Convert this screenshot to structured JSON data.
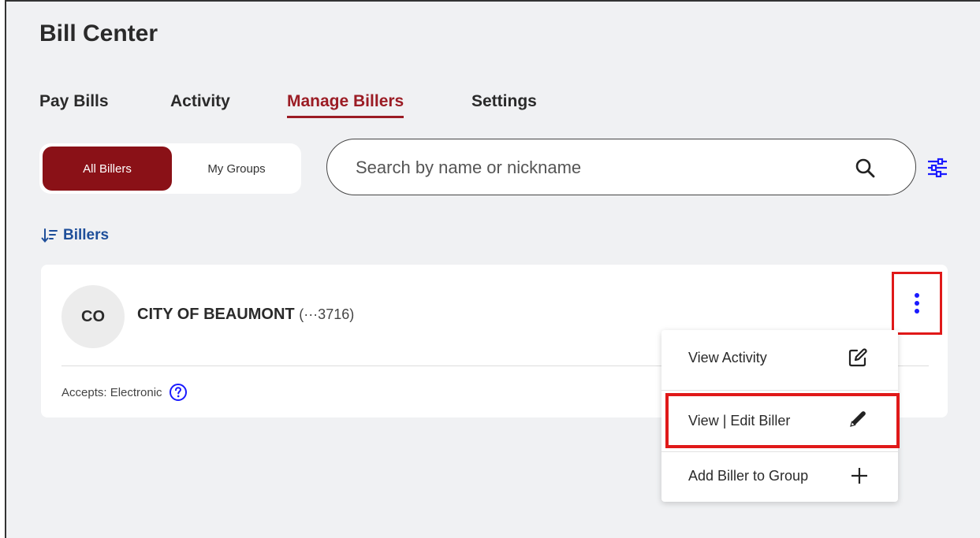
{
  "page": {
    "title": "Bill Center"
  },
  "tabs": [
    {
      "label": "Pay Bills",
      "active": false
    },
    {
      "label": "Activity",
      "active": false
    },
    {
      "label": "Manage Billers",
      "active": true
    },
    {
      "label": "Settings",
      "active": false
    }
  ],
  "segment": {
    "all_label": "All Billers",
    "groups_label": "My Groups",
    "selected": "All Billers"
  },
  "search": {
    "placeholder": "Search by name or nickname",
    "value": ""
  },
  "sort": {
    "label": "Billers"
  },
  "biller": {
    "initials": "CO",
    "name": "CITY OF BEAUMONT",
    "account": "(···3716)",
    "accepts": "Accepts: Electronic"
  },
  "menu": {
    "items": [
      {
        "label": "View Activity",
        "icon": "edit-square-icon"
      },
      {
        "label": "View | Edit Biller",
        "icon": "pencil-icon"
      },
      {
        "label": "Add Biller to Group",
        "icon": "plus-icon"
      }
    ]
  },
  "colors": {
    "brand": "#8a1117",
    "active_tab": "#9b1c24",
    "link_blue": "#1f4f9a",
    "icon_blue": "#1a1aff",
    "highlight_red": "#e01919"
  }
}
